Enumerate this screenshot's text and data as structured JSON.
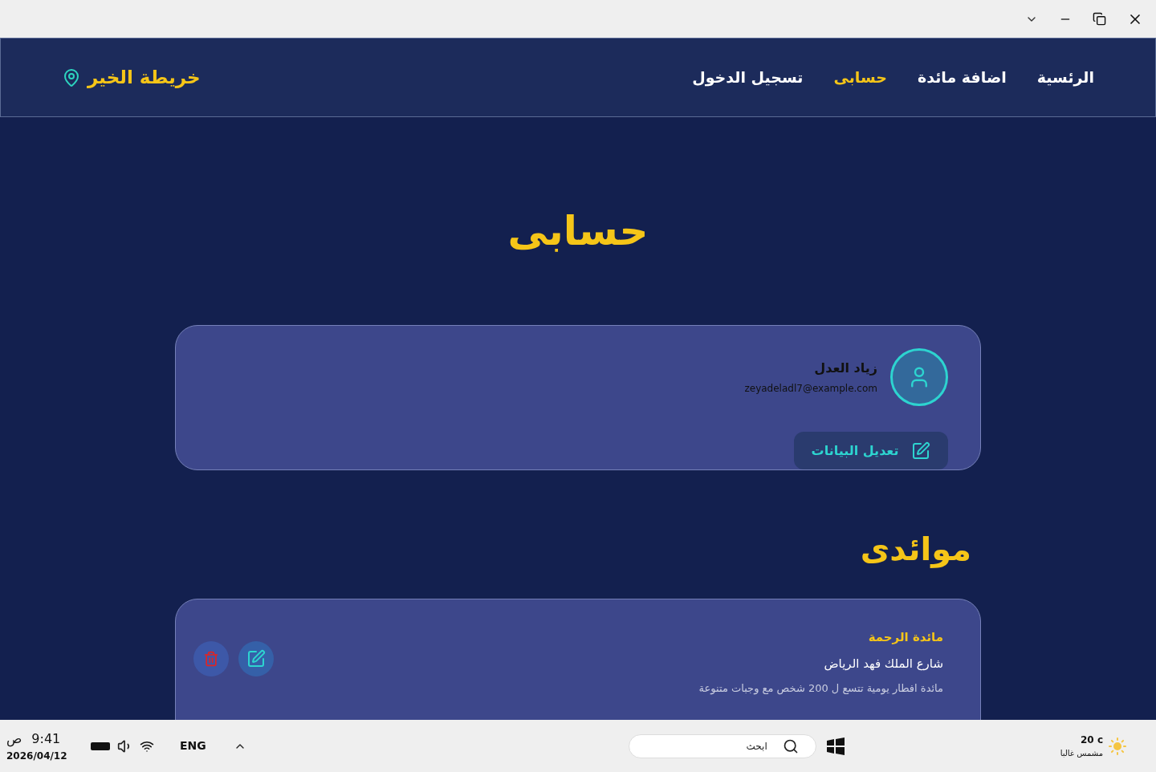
{
  "nav": {
    "brand": "خريطة الخير",
    "links": [
      {
        "label": "الرئسية",
        "selected": false
      },
      {
        "label": "اضافة مائدة",
        "selected": false
      },
      {
        "label": "حسابى",
        "selected": true
      },
      {
        "label": "تسجيل الدخول",
        "selected": false
      }
    ]
  },
  "page_title": "حسابى",
  "profile": {
    "name": "زياد العدل",
    "email": "zeyadeladl7@example.com",
    "edit_button": "تعديل البيانات"
  },
  "tables_section": {
    "title": "موائدى",
    "tables": [
      {
        "name": "مائدة الرحمة",
        "address": "شارع الملك فهد الرياض",
        "description": "مائدة افطار يومية تتسع ل 200 شخص مع وجبات متنوعة"
      }
    ]
  },
  "taskbar": {
    "time": "9:41",
    "period": "ص",
    "date": "2026/04/12",
    "language": "ENG",
    "search_placeholder": "ابحث",
    "temperature": "20 c",
    "weather": "مشمس غالبا"
  }
}
